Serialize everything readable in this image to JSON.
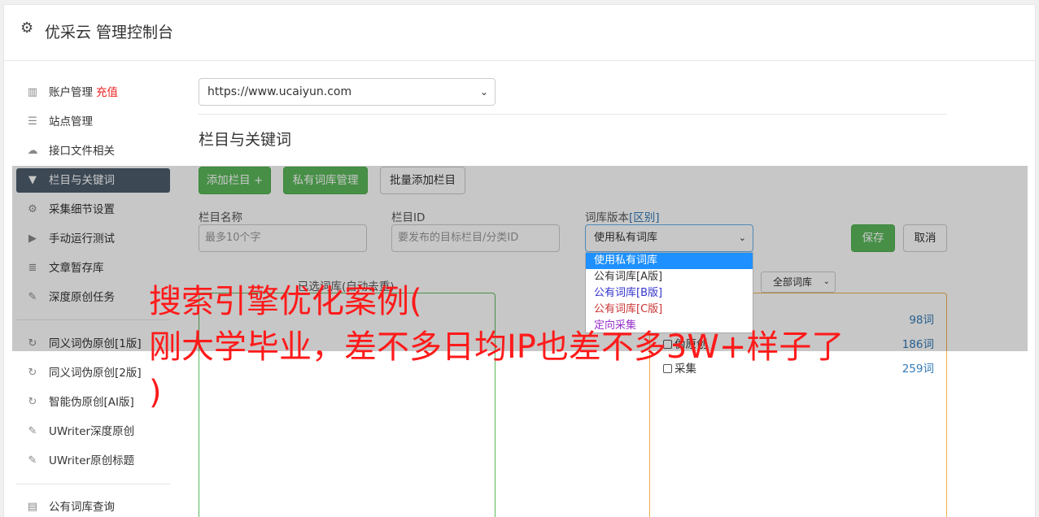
{
  "header": {
    "title": "优采云 管理控制台",
    "icon": "gear-icon"
  },
  "sidebar": {
    "items": [
      {
        "label": "账户管理",
        "badge": "充值",
        "icon": "bar-chart-icon"
      },
      {
        "label": "站点管理",
        "icon": "server-icon"
      },
      {
        "label": "接口文件相关",
        "icon": "cloud-upload-icon"
      },
      {
        "label": "栏目与关键词",
        "icon": "filter-icon",
        "active": true
      },
      {
        "label": "采集细节设置",
        "icon": "cogs-icon"
      },
      {
        "label": "手动运行测试",
        "icon": "play-circle-icon"
      },
      {
        "label": "文章暂存库",
        "icon": "database-icon"
      },
      {
        "label": "深度原创任务",
        "icon": "edit-icon"
      },
      {
        "label": "同义词伪原创[1版]",
        "icon": "refresh-icon"
      },
      {
        "label": "同义词伪原创[2版]",
        "icon": "refresh-icon"
      },
      {
        "label": "智能伪原创[AI版]",
        "icon": "refresh-icon"
      },
      {
        "label": "UWriter深度原创",
        "icon": "edit-icon"
      },
      {
        "label": "UWriter原创标题",
        "icon": "edit-icon"
      },
      {
        "label": "公有词库查询",
        "icon": "book-icon"
      }
    ]
  },
  "main": {
    "site_select": "https://www.ucaiyun.com",
    "section_title": "栏目与关键词",
    "buttons": {
      "add_column": "添加栏目 +",
      "private_lib": "私有词库管理",
      "batch_add": "批量添加栏目",
      "save": "保存",
      "cancel": "取消"
    },
    "fields": {
      "column_name_label": "栏目名称",
      "column_name_placeholder": "最多10个字",
      "column_id_label": "栏目ID",
      "column_id_placeholder": "要发布的目标栏目/分类ID",
      "version_label": "词库版本",
      "version_link": "[区别]",
      "version_value": "使用私有词库"
    },
    "version_options": [
      {
        "label": "使用私有词库",
        "color": "#ffffff"
      },
      {
        "label": "公有词库[A版]",
        "color": "#333333"
      },
      {
        "label": "公有词库[B版]",
        "color": "#3333cc"
      },
      {
        "label": "公有词库[C版]",
        "color": "#cc3333"
      },
      {
        "label": "定向采集",
        "color": "#9933cc"
      }
    ],
    "selected_words_title": "已选词库(自动去重)",
    "lib_filter": "全部词库",
    "libraries": [
      {
        "name": "",
        "count": "98词"
      },
      {
        "name": "伪原创",
        "count": "186词"
      },
      {
        "name": "采集",
        "count": "259词"
      }
    ]
  },
  "ad_text": "搜索引擎优化案例(\n刚大学毕业，差不多日均IP也差不多3W+样子了\n)"
}
